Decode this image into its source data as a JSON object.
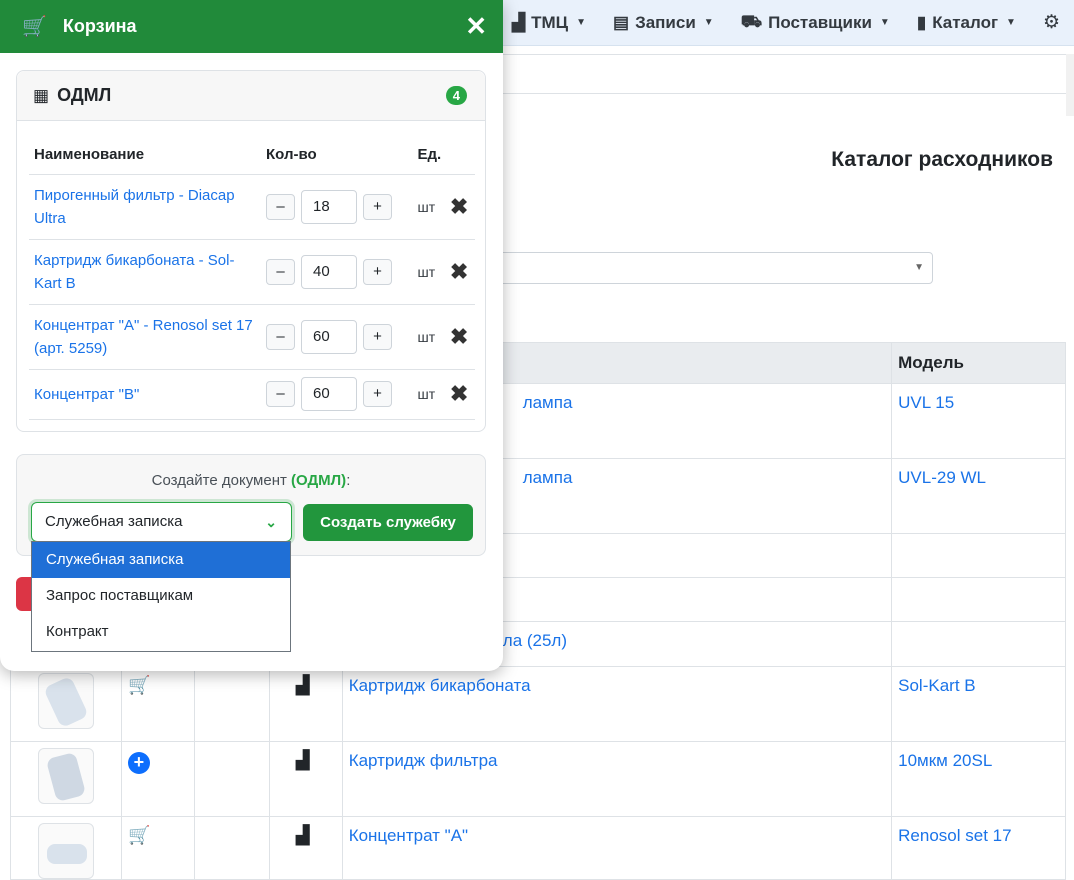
{
  "nav": {
    "items": [
      {
        "label": "ТМЦ",
        "icon": "boxes-icon"
      },
      {
        "label": "Записи",
        "icon": "clipboard-icon"
      },
      {
        "label": "Поставщики",
        "icon": "truck-icon"
      },
      {
        "label": "Каталог",
        "icon": "book-icon"
      }
    ],
    "settings_icon": "gear-icon"
  },
  "page": {
    "title": "Каталог расходников",
    "table_header_model": "Модель",
    "rows": [
      {
        "name": "лампа",
        "model": "UVL 15"
      },
      {
        "name": "лампа",
        "model": "UVL-29 WL"
      },
      {
        "name": "",
        "model": ""
      },
      {
        "name": "",
        "model": ""
      },
      {
        "name": "ола (25л)",
        "model": ""
      },
      {
        "name": "Картридж бикарбоната",
        "model": "Sol-Kart B",
        "action": "cart"
      },
      {
        "name": "Картридж фильтра",
        "model": "10мкм 20SL",
        "action": "add"
      },
      {
        "name": "Концентрат \"А\"",
        "model": "Renosol set 17",
        "action": "cart"
      }
    ]
  },
  "cart": {
    "title": "Корзина",
    "close_icon": "close-icon",
    "group": {
      "name": "ОДМЛ",
      "count": "4",
      "headers": {
        "name": "Наименование",
        "qty": "Кол-во",
        "unit": "Ед."
      },
      "items": [
        {
          "name": "Пирогенный фильтр - Diacap Ultra",
          "qty": "18",
          "unit": "шт"
        },
        {
          "name": "Картридж бикарбоната - Sol-Kart B",
          "qty": "40",
          "unit": "шт"
        },
        {
          "name": "Концентрат \"А\" - Renosol set 17 (арт. 5259)",
          "qty": "60",
          "unit": "шт"
        },
        {
          "name": "Концентрат \"В\"",
          "qty": "60",
          "unit": "шт"
        }
      ],
      "minus": "–",
      "plus": "+"
    },
    "create": {
      "label_prefix": "Создайте документ ",
      "label_group": "(ОДМЛ)",
      "label_suffix": ":",
      "selected": "Служебная записка",
      "button": "Создать служебку",
      "options": [
        "Служебная записка",
        "Запрос поставщикам",
        "Контракт"
      ]
    }
  },
  "colors": {
    "header_green": "#218a3a",
    "accent_blue": "#1f6fd6",
    "link": "#1a73e8"
  }
}
